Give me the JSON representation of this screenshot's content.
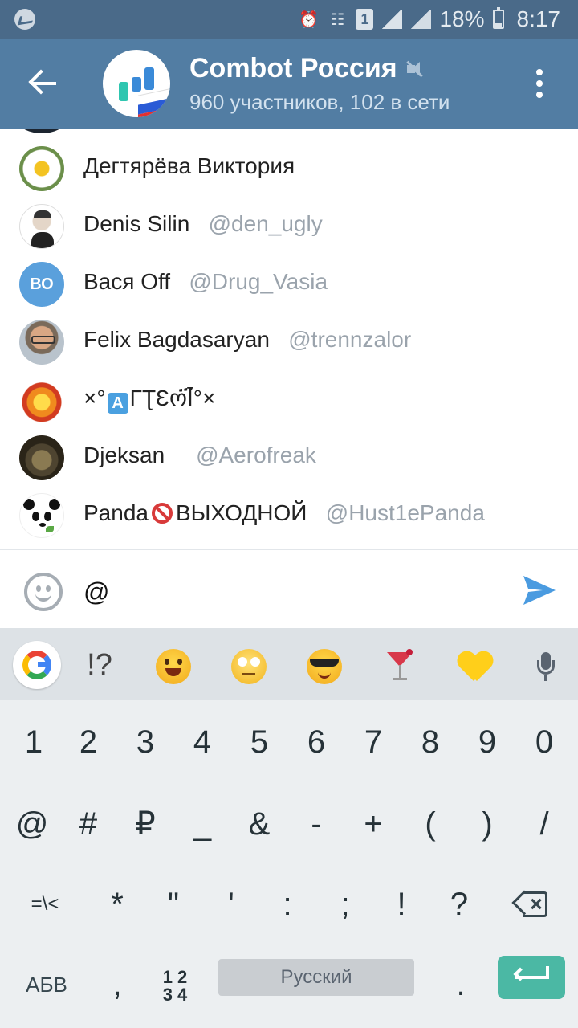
{
  "status_bar": {
    "battery": "18%",
    "time": "8:17",
    "sim_number": "1"
  },
  "header": {
    "title": "Combot Россия",
    "subtitle": "960 участников, 102 в сети"
  },
  "mentions": [
    {
      "name": "Дегтярёва Виктория",
      "username": ""
    },
    {
      "name": "Denis Silin",
      "username": "@den_ugly"
    },
    {
      "name": "Вася Off",
      "username": "@Drug_Vasia",
      "initials": "ВО"
    },
    {
      "name": "Felix Bagdasaryan",
      "username": "@trennzalor"
    },
    {
      "name_prefix": "×°",
      "name_suffix": "ΓƮƐოĪ፝°×",
      "username": ""
    },
    {
      "name": "Djeksan",
      "username": "@Aerofreak"
    },
    {
      "name_prefix": "Panda",
      "name_suffix": "ВЫХОДНОЙ",
      "username": "@Hust1ePanda"
    }
  ],
  "composer": {
    "value": "@"
  },
  "keyboard": {
    "suggestion_symbols": "!?",
    "row1": [
      "1",
      "2",
      "3",
      "4",
      "5",
      "6",
      "7",
      "8",
      "9",
      "0"
    ],
    "row2": [
      "@",
      "#",
      "₽",
      "_",
      "&",
      "-",
      "+",
      "(",
      ")",
      "/"
    ],
    "row3": [
      "=\\<",
      "*",
      "\"",
      "'",
      ":",
      ";",
      "!",
      "?"
    ],
    "row4": {
      "abc": "АБВ",
      "comma": ",",
      "num_top": "1 2",
      "num_bottom": "3 4",
      "space": "Русский",
      "period": "."
    }
  },
  "colors": {
    "status_bar": "#4a6a89",
    "header": "#527da3",
    "send": "#4a9be0",
    "enter": "#4bb8a4"
  }
}
